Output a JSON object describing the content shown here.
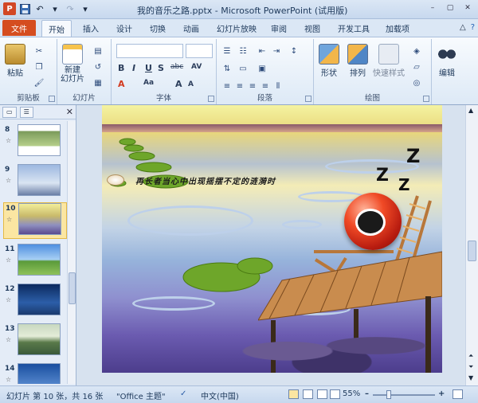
{
  "window": {
    "title": "我的音乐之路.pptx - Microsoft PowerPoint (试用版)",
    "controls": [
      "–",
      "▢",
      "✕"
    ]
  },
  "qat": {
    "logo": "P",
    "undo": "↶",
    "redo": "↷"
  },
  "tabs": {
    "file": "文件",
    "items": [
      "开始",
      "插入",
      "设计",
      "切换",
      "动画",
      "幻灯片放映",
      "审阅",
      "视图",
      "开发工具",
      "加载项"
    ],
    "active": "开始"
  },
  "ribbon": {
    "clipboard": {
      "paste": "粘贴",
      "label": "剪贴板"
    },
    "slides": {
      "new_slide": "新建\n幻灯片",
      "label": "幻灯片"
    },
    "font": {
      "label": "字体",
      "bold": "B",
      "italic": "I",
      "underline": "U",
      "strike": "S",
      "shadow": "abc",
      "size_up": "A",
      "size_down": "A",
      "spacing": "AV",
      "case": "Aa",
      "color": "A"
    },
    "paragraph": {
      "label": "段落"
    },
    "drawing": {
      "shapes": "形状",
      "arrange": "排列",
      "quick_styles": "快速样式",
      "label": "绘图"
    },
    "editing": {
      "label": "编辑"
    }
  },
  "thumbnails": [
    {
      "num": "8"
    },
    {
      "num": "9"
    },
    {
      "num": "10",
      "selected": true
    },
    {
      "num": "11"
    },
    {
      "num": "12"
    },
    {
      "num": "13"
    },
    {
      "num": "14"
    }
  ],
  "slide": {
    "caption": "再长者当心中出现摇摆不定的涟漪时",
    "zzz": [
      "Z",
      "Z",
      "Z"
    ]
  },
  "status": {
    "slide_info": "幻灯片 第 10 张，共 16 张",
    "theme": "\"Office 主题\"",
    "language": "中文(中国)",
    "zoom": "55%",
    "minus": "–",
    "plus": "+"
  },
  "colors": {
    "file_tab": "#d54d1f",
    "ribbon_bg": "#dde9f6",
    "selected_thumb": "#fbe6a2"
  }
}
